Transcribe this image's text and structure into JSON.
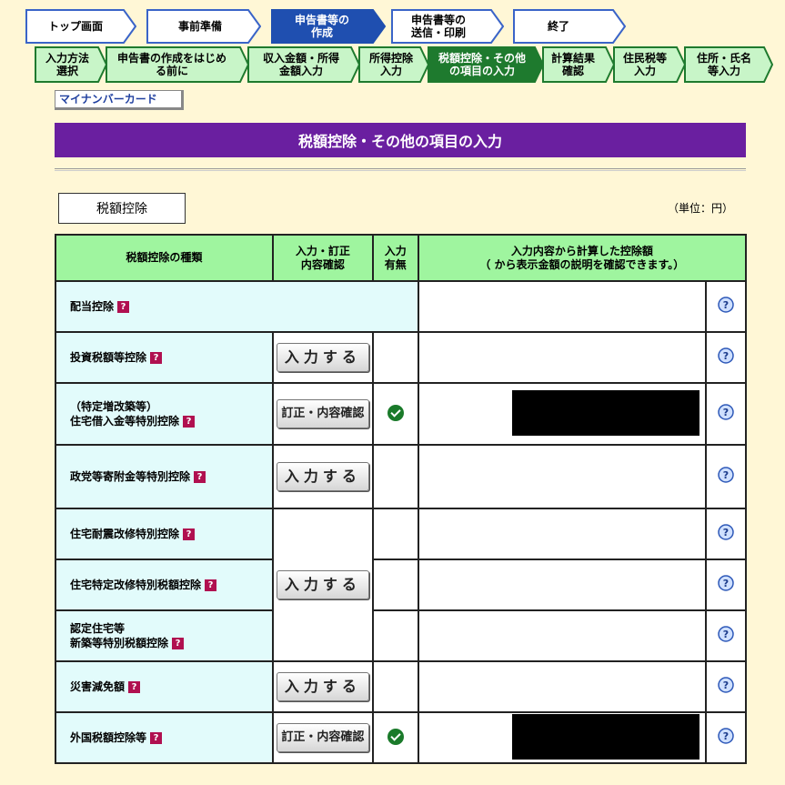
{
  "top_steps": [
    {
      "label": "トップ画面",
      "state": "done"
    },
    {
      "label": "事前準備",
      "state": "done"
    },
    {
      "label": "申告書等の\n作成",
      "state": "current"
    },
    {
      "label": "申告書等の\n送信・印刷",
      "state": "todo"
    },
    {
      "label": "終了",
      "state": "todo"
    }
  ],
  "sub_steps": [
    {
      "label": "入力方法\n選択",
      "state": "done"
    },
    {
      "label": "申告書の作成をはじめ\nる前に",
      "state": "done"
    },
    {
      "label": "収入金額・所得\n金額入力",
      "state": "done"
    },
    {
      "label": "所得控除\n入力",
      "state": "done"
    },
    {
      "label": "税額控除・その他\nの項目の入力",
      "state": "current"
    },
    {
      "label": "計算結果\n確認",
      "state": "todo"
    },
    {
      "label": "住民税等\n入力",
      "state": "todo"
    },
    {
      "label": "住所・氏名\n等入力",
      "state": "todo"
    }
  ],
  "card_tab": "マイナンバーカード",
  "page_title": "税額控除・その他の項目の入力",
  "section_label": "税額控除",
  "unit_label": "（単位：円）",
  "table": {
    "headers": {
      "type": "税額控除の種類",
      "action": "入力・訂正\n内容確認",
      "status": "入力\n有無",
      "amount_line1": "入力内容から計算した控除額",
      "amount_line2": "（  から表示金額の説明を確認できます。）"
    },
    "rows": [
      {
        "name": "配当控除"
      },
      {
        "name": "投資税額等控除",
        "button": "入力する"
      },
      {
        "name": "（特定増改築等）\n住宅借入金等特別控除",
        "button": "訂正・内容確認",
        "checked": true
      },
      {
        "name": "政党等寄附金等特別控除",
        "button": "入力する"
      },
      {
        "name": "住宅耐震改修特別控除"
      },
      {
        "name": "住宅特定改修特別税額控除",
        "button": "入力する"
      },
      {
        "name": "認定住宅等\n新築等特別税額控除"
      },
      {
        "name": "災害減免額",
        "button": "入力する"
      },
      {
        "name": "外国税額控除等",
        "button": "訂正・内容確認",
        "checked": true
      }
    ]
  },
  "colors": {
    "current_step": "#1f4fb0",
    "done_step": "#dfe9ff",
    "sub_current": "#1e7a2e",
    "sub_other": "#c8f5c8",
    "title_bar": "#6a1fa0",
    "header_bg": "#9ff59f",
    "name_bg": "#e2fbfb"
  }
}
